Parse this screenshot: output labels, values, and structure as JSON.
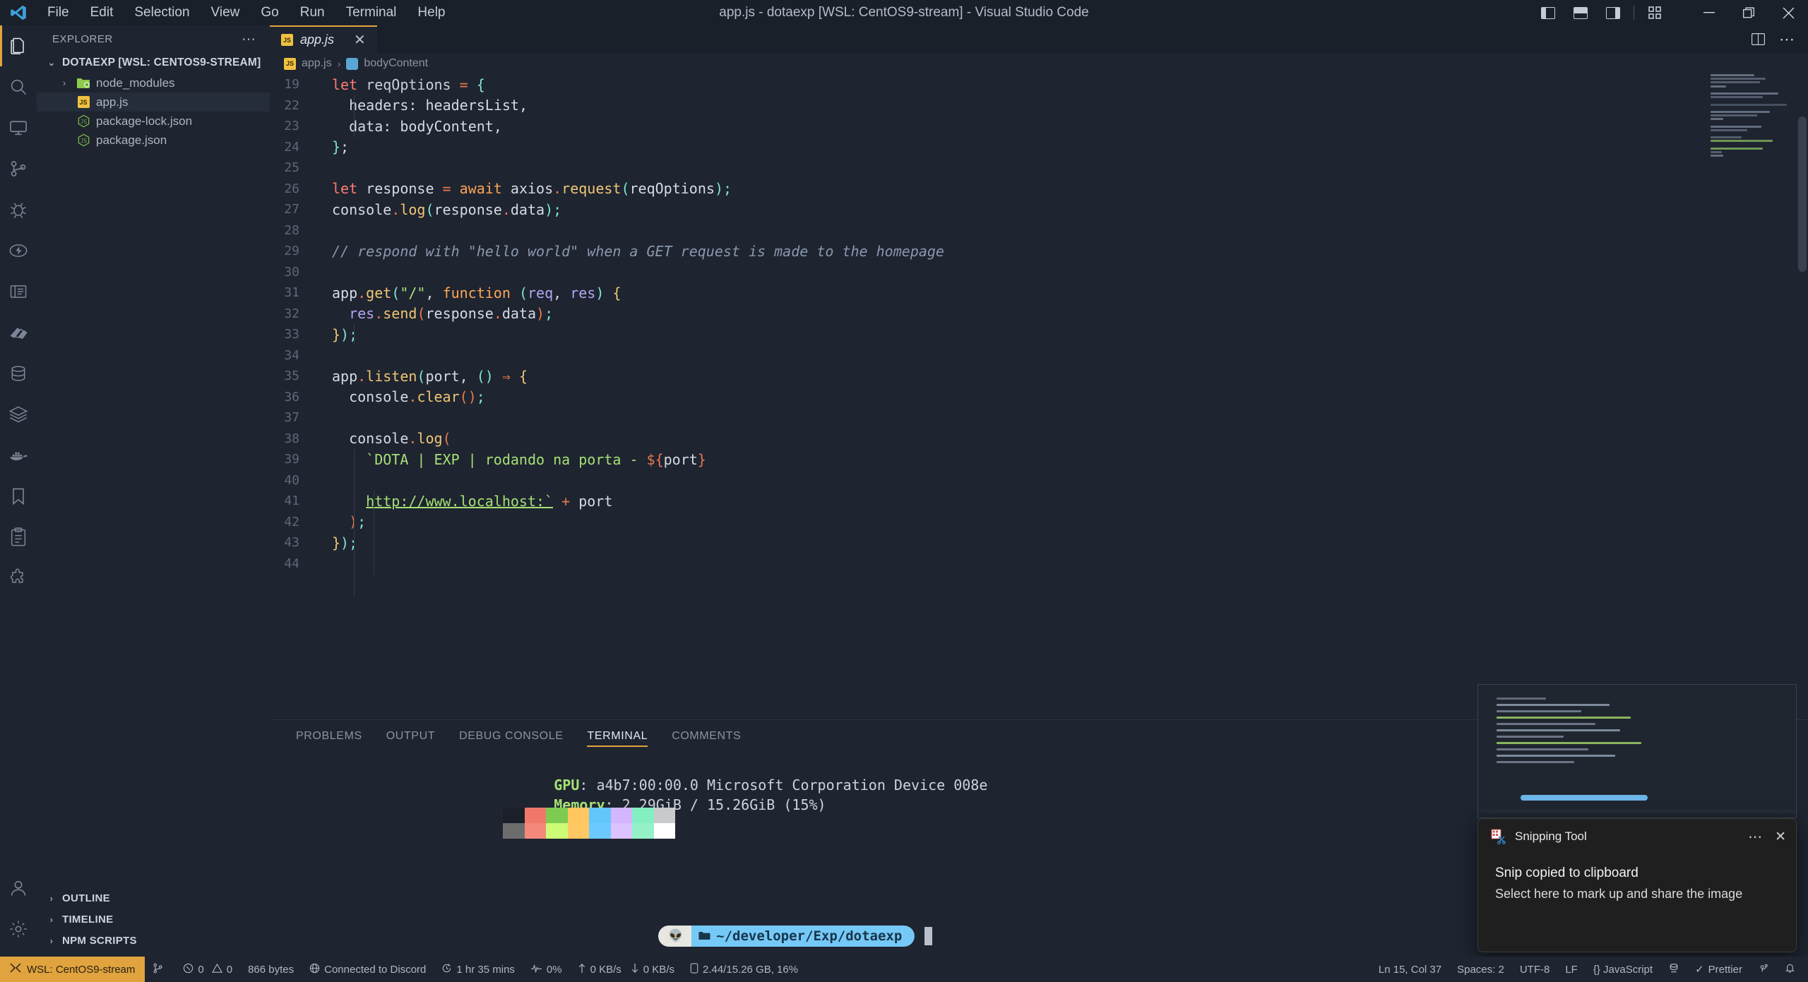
{
  "titlebar": {
    "logo_icon": "vscode-logo-icon",
    "title": "app.js - dotaexp [WSL: CentOS9-stream] - Visual Studio Code",
    "menus": [
      "File",
      "Edit",
      "Selection",
      "View",
      "Go",
      "Run",
      "Terminal",
      "Help"
    ],
    "layout_icons": [
      {
        "name": "toggle-primary-sidebar-icon",
        "glyph": "▣"
      },
      {
        "name": "toggle-panel-icon",
        "glyph": "▤"
      },
      {
        "name": "toggle-secondary-sidebar-icon",
        "glyph": "▥"
      },
      {
        "name": "customize-layout-icon",
        "glyph": "▦"
      }
    ],
    "window_controls": [
      {
        "name": "minimize-button",
        "glyph": "—"
      },
      {
        "name": "maximize-button",
        "glyph": "❐"
      },
      {
        "name": "close-button",
        "glyph": "✕"
      }
    ]
  },
  "activitybar": {
    "items": [
      {
        "name": "activity-explorer",
        "icon": "files-icon",
        "active": true
      },
      {
        "name": "activity-search",
        "icon": "search-icon",
        "active": false
      },
      {
        "name": "activity-remote-explorer",
        "icon": "monitor-icon",
        "active": false
      },
      {
        "name": "activity-source-control",
        "icon": "source-control-icon",
        "active": false
      },
      {
        "name": "activity-run-debug",
        "icon": "bug-icon",
        "active": false
      },
      {
        "name": "activity-thunder-client",
        "icon": "lightning-icon",
        "active": false
      },
      {
        "name": "activity-todo",
        "icon": "book-icon",
        "active": false
      },
      {
        "name": "activity-themes",
        "icon": "palette-icon",
        "active": false
      },
      {
        "name": "activity-database",
        "icon": "database-icon",
        "active": false
      },
      {
        "name": "activity-layers",
        "icon": "layers-icon",
        "active": false
      },
      {
        "name": "activity-docker",
        "icon": "docker-whale-icon",
        "active": false
      },
      {
        "name": "activity-bookmarks",
        "icon": "bookmark-icon",
        "active": false
      },
      {
        "name": "activity-tasks",
        "icon": "clipboard-icon",
        "active": false
      },
      {
        "name": "activity-extensions",
        "icon": "extensions-icon",
        "active": false
      }
    ],
    "bottom": [
      {
        "name": "activity-accounts",
        "icon": "account-icon"
      },
      {
        "name": "activity-settings",
        "icon": "gear-icon"
      }
    ]
  },
  "sidebar": {
    "header": "EXPLORER",
    "more_actions": "⋯",
    "root": "DOTAEXP [WSL: CENTOS9-STREAM]",
    "files": [
      {
        "label": "node_modules",
        "type": "folder",
        "icon": "node-folder-icon",
        "selected": false,
        "expandable": true
      },
      {
        "label": "app.js",
        "type": "file",
        "icon": "js-file-icon",
        "selected": true,
        "expandable": false
      },
      {
        "label": "package-lock.json",
        "type": "file",
        "icon": "npm-json-icon",
        "selected": false,
        "expandable": false
      },
      {
        "label": "package.json",
        "type": "file",
        "icon": "npm-json-icon",
        "selected": false,
        "expandable": false
      }
    ],
    "sections": [
      "OUTLINE",
      "TIMELINE",
      "NPM SCRIPTS"
    ]
  },
  "editor": {
    "tab": {
      "label": "app.js",
      "icon": "js-file-icon",
      "close": "✕"
    },
    "tab_actions": [
      {
        "name": "split-editor-icon",
        "glyph": "⊞"
      },
      {
        "name": "editor-more-actions-icon",
        "glyph": "⋯"
      }
    ],
    "breadcrumbs": [
      {
        "label": "app.js",
        "icon": "js-file-icon"
      },
      {
        "label": "bodyContent",
        "icon": "symbol-variable-icon"
      }
    ],
    "first_line_number": 19,
    "lines": [
      {
        "n": "19",
        "text": "let reqOptions = {"
      },
      {
        "n": "22",
        "text": "  headers: headersList,"
      },
      {
        "n": "23",
        "text": "  data: bodyContent,"
      },
      {
        "n": "24",
        "text": "};"
      },
      {
        "n": "25",
        "text": ""
      },
      {
        "n": "26",
        "text": "let response = await axios.request(reqOptions);"
      },
      {
        "n": "27",
        "text": "console.log(response.data);"
      },
      {
        "n": "28",
        "text": ""
      },
      {
        "n": "29",
        "text": "// respond with \"hello world\" when a GET request is made to the homepage"
      },
      {
        "n": "30",
        "text": ""
      },
      {
        "n": "31",
        "text": "app.get(\"/\", function (req, res) {"
      },
      {
        "n": "32",
        "text": "  res.send(response.data);"
      },
      {
        "n": "33",
        "text": "});"
      },
      {
        "n": "34",
        "text": ""
      },
      {
        "n": "35",
        "text": "app.listen(port, () => {"
      },
      {
        "n": "36",
        "text": "  console.clear();"
      },
      {
        "n": "37",
        "text": ""
      },
      {
        "n": "38",
        "text": "  console.log("
      },
      {
        "n": "39",
        "text": "    `DOTA | EXP | rodando na porta - ${port}"
      },
      {
        "n": "40",
        "text": ""
      },
      {
        "n": "41",
        "text": "    http://www.localhost:` + port"
      },
      {
        "n": "42",
        "text": "  );"
      },
      {
        "n": "43",
        "text": "});"
      },
      {
        "n": "44",
        "text": ""
      }
    ]
  },
  "panel": {
    "tabs": [
      "PROBLEMS",
      "OUTPUT",
      "DEBUG CONSOLE",
      "TERMINAL",
      "COMMENTS"
    ],
    "active_tab": "TERMINAL",
    "terminal": {
      "lines": [
        {
          "key": "GPU",
          "value": "a4b7:00:00.0 Microsoft Corporation Device 008e"
        },
        {
          "key": "Memory",
          "value": "2.29GiB / 15.26GiB (15%)"
        }
      ],
      "palette_top": [
        "#1a1f29",
        "#f0786a",
        "#7ecb52",
        "#ffc660",
        "#62c6fb",
        "#d4b6fe",
        "#84efc2",
        "#c8cacb"
      ],
      "palette_bottom": [
        "#6d6d6d",
        "#f4887a",
        "#ccfb75",
        "#ffc862",
        "#6cc9fd",
        "#dcc2ff",
        "#94f0c7",
        "#ffffff"
      ],
      "prompt_avatar": "alien-emoji-icon",
      "prompt_folder_icon": "folder-icon",
      "prompt_path": "~/developer/Exp/dotaexp"
    }
  },
  "statusbar": {
    "remote": {
      "icon": "remote-indicator-icon",
      "label": "WSL: CentOS9-stream"
    },
    "left_items": [
      {
        "name": "status-branch",
        "icon": "source-control-icon",
        "label": ""
      },
      {
        "name": "status-problems",
        "icon": "error-warning-icon",
        "label": "0  0"
      },
      {
        "name": "status-filesize",
        "icon": "",
        "label": "866 bytes"
      },
      {
        "name": "status-discord",
        "icon": "globe-icon",
        "label": "Connected to Discord"
      },
      {
        "name": "status-uptime",
        "icon": "clock-icon",
        "label": "1 hr 35 mins"
      },
      {
        "name": "status-cpu",
        "icon": "pulse-icon",
        "label": "0%"
      },
      {
        "name": "status-network",
        "icon": "network-icon",
        "label": "0 KB/s  0 KB/s"
      },
      {
        "name": "status-disk",
        "icon": "disk-icon",
        "label": "2.44/15.26 GB, 16%"
      }
    ],
    "right_items": [
      {
        "name": "status-cursor-position",
        "label": "Ln 15, Col 37"
      },
      {
        "name": "status-indentation",
        "label": "Spaces: 2"
      },
      {
        "name": "status-encoding",
        "label": "UTF-8"
      },
      {
        "name": "status-eol",
        "label": "LF"
      },
      {
        "name": "status-language-mode",
        "label": "{} JavaScript"
      },
      {
        "name": "status-port-forward",
        "label": ""
      },
      {
        "name": "status-formatter",
        "label": "✓ Prettier"
      },
      {
        "name": "status-gitlens",
        "label": ""
      },
      {
        "name": "status-notifications",
        "label": ""
      }
    ]
  },
  "toast": {
    "app_icon": "snipping-tool-icon",
    "app_name": "Snipping Tool",
    "more": "⋯",
    "close": "✕",
    "title": "Snip copied to clipboard",
    "subtitle": "Select here to mark up and share the image"
  },
  "colors": {
    "accent": "#e0a33e",
    "editor_bg": "#1e2430",
    "titlebar_bg": "#1a2029",
    "status_remote_bg": "#e0a33e",
    "string_green": "#a5e075",
    "keyword_red": "#ff7b72"
  }
}
